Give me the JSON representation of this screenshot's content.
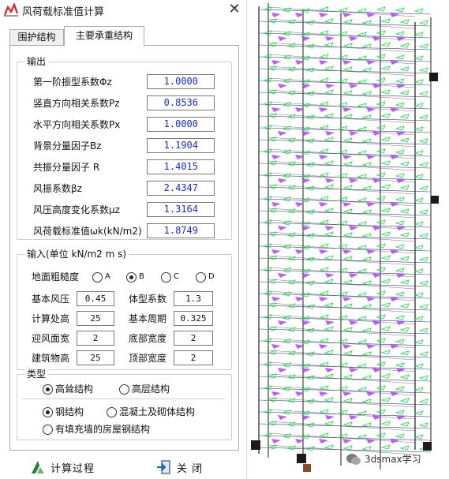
{
  "window": {
    "title": "风荷载标准值计算"
  },
  "tabs": [
    {
      "label": "围护结构",
      "active": false
    },
    {
      "label": "主要承重结构",
      "active": true
    }
  ],
  "output": {
    "group_title": "输出",
    "rows": [
      {
        "label": "第一阶振型系数Φz",
        "value": "1.0000"
      },
      {
        "label": "竖直方向相关系数Pz",
        "value": "0.8536"
      },
      {
        "label": "水平方向相关系数Px",
        "value": "1.0000"
      },
      {
        "label": "背景分量因子Bz",
        "value": "1.1904"
      },
      {
        "label": "共振分量因子 R",
        "value": "1.4015"
      },
      {
        "label": "风振系数βz",
        "value": "2.4347"
      },
      {
        "label": "风压高度变化系数μz",
        "value": "1.3164"
      },
      {
        "label": "风荷载标准值ωk(kN/m2)",
        "value": "1.8749"
      }
    ]
  },
  "input": {
    "group_title": "输入(单位 kN/m2 m s)",
    "roughness": {
      "label": "地面粗糙度",
      "options": [
        "A",
        "B",
        "C",
        "D"
      ],
      "selected": "B"
    },
    "fields": [
      {
        "label": "基本风压",
        "value": "0.45"
      },
      {
        "label": "体型系数",
        "value": "1.3"
      },
      {
        "label": "计算处高",
        "value": "25"
      },
      {
        "label": "基本周期",
        "value": "0.325"
      },
      {
        "label": "迎风面宽",
        "value": "2"
      },
      {
        "label": "底部宽度",
        "value": "2"
      },
      {
        "label": "建筑物高",
        "value": "25"
      },
      {
        "label": "顶部宽度",
        "value": "2"
      }
    ]
  },
  "type": {
    "group_title": "类型",
    "structure_options": [
      "高耸结构",
      "高层结构"
    ],
    "structure_selected": "高耸结构",
    "material_options": [
      "钢结构",
      "混凝土及砌体结构",
      "有填充墙的房屋钢结构"
    ],
    "material_selected": "钢结构"
  },
  "footer": {
    "calc_label": "计算过程",
    "close_label": "关 闭"
  },
  "watermark": {
    "text": "3dsmax学习"
  },
  "icons": {
    "app": "chart-icon",
    "close": "close-icon",
    "calc": "calc-process-icon",
    "exit": "exit-icon",
    "wechat": "wechat-icon"
  },
  "colors": {
    "output_value": "#1a2bd6",
    "model_green": "#22e04a",
    "model_magenta": "#b040ff",
    "model_frame": "#1a1a1a"
  }
}
